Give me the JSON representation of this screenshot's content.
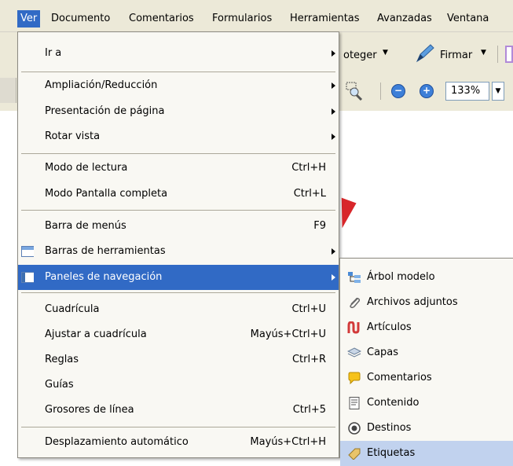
{
  "menubar": {
    "items": [
      "Ver",
      "Documento",
      "Comentarios",
      "Formularios",
      "Herramientas",
      "Avanzadas",
      "Ventana"
    ]
  },
  "toolbar": {
    "proteger_label": "oteger",
    "firmar_label": "Firmar",
    "zoom_value": "133%"
  },
  "view_menu": {
    "items": [
      {
        "label": "Ir a",
        "shortcut": "",
        "submenu": true
      },
      {
        "label": "Ampliación/Reducción",
        "shortcut": "",
        "submenu": true
      },
      {
        "label": "Presentación de página",
        "shortcut": "",
        "submenu": true
      },
      {
        "label": "Rotar vista",
        "shortcut": "",
        "submenu": true
      },
      {
        "label": "Modo de lectura",
        "shortcut": "Ctrl+H",
        "submenu": false
      },
      {
        "label": "Modo Pantalla completa",
        "shortcut": "Ctrl+L",
        "submenu": false
      },
      {
        "label": "Barra de menús",
        "shortcut": "F9",
        "submenu": false
      },
      {
        "label": "Barras de herramientas",
        "shortcut": "",
        "submenu": true
      },
      {
        "label": "Paneles de navegación",
        "shortcut": "",
        "submenu": true
      },
      {
        "label": "Cuadrícula",
        "shortcut": "Ctrl+U",
        "submenu": false
      },
      {
        "label": "Ajustar a cuadrícula",
        "shortcut": "Mayús+Ctrl+U",
        "submenu": false
      },
      {
        "label": "Reglas",
        "shortcut": "Ctrl+R",
        "submenu": false
      },
      {
        "label": "Guías",
        "shortcut": "",
        "submenu": false
      },
      {
        "label": "Grosores de línea",
        "shortcut": "Ctrl+5",
        "submenu": false
      },
      {
        "label": "Desplazamiento automático",
        "shortcut": "Mayús+Ctrl+H",
        "submenu": false
      }
    ]
  },
  "nav_panels_submenu": {
    "items": [
      {
        "label": "Árbol modelo",
        "icon": "model-tree-icon"
      },
      {
        "label": "Archivos adjuntos",
        "icon": "paperclip-icon"
      },
      {
        "label": "Artículos",
        "icon": "articles-icon"
      },
      {
        "label": "Capas",
        "icon": "layers-icon"
      },
      {
        "label": "Comentarios",
        "icon": "comment-icon"
      },
      {
        "label": "Contenido",
        "icon": "content-icon"
      },
      {
        "label": "Destinos",
        "icon": "destinations-icon"
      },
      {
        "label": "Etiquetas",
        "icon": "tag-icon"
      }
    ]
  },
  "colors": {
    "highlight": "#316ac5",
    "sub_highlight": "#c1d2ee",
    "menu_bg": "#f9f8f3",
    "chrome": "#ece9d8"
  }
}
